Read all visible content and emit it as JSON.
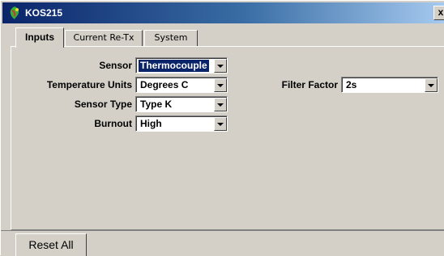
{
  "window": {
    "title": "KOS215",
    "close_glyph": "x"
  },
  "tabs": [
    {
      "label": "Inputs",
      "active": true
    },
    {
      "label": "Current Re-Tx",
      "active": false
    },
    {
      "label": "System",
      "active": false
    }
  ],
  "fields": {
    "sensor": {
      "label": "Sensor",
      "value": "Thermocouple"
    },
    "temperature_units": {
      "label": "Temperature Units",
      "value": "Degrees C"
    },
    "sensor_type": {
      "label": "Sensor Type",
      "value": "Type K"
    },
    "burnout": {
      "label": "Burnout",
      "value": "High"
    },
    "filter_factor": {
      "label": "Filter Factor",
      "value": "2s"
    }
  },
  "footer": {
    "reset_label": "Reset All"
  },
  "icons": {
    "app": "app-logo-icon",
    "close": "close-icon",
    "dropdown": "chevron-down-icon"
  },
  "colors": {
    "titlebar_start": "#0a246a",
    "titlebar_end": "#a6caf0",
    "selection": "#0a246a",
    "face": "#d4d0c8"
  }
}
